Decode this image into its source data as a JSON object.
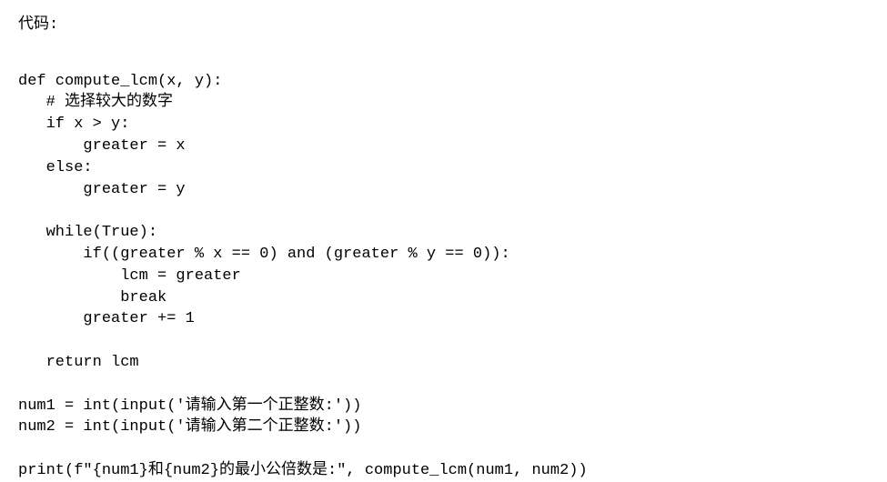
{
  "heading": "代码:",
  "code": {
    "line01": "def compute_lcm(x, y):",
    "line02": "   # 选择较大的数字",
    "line03": "   if x > y:",
    "line04": "       greater = x",
    "line05": "   else:",
    "line06": "       greater = y",
    "line07": "",
    "line08": "   while(True):",
    "line09": "       if((greater % x == 0) and (greater % y == 0)):",
    "line10": "           lcm = greater",
    "line11": "           break",
    "line12": "       greater += 1",
    "line13": "",
    "line14": "   return lcm",
    "line15": "",
    "line16": "num1 = int(input('请输入第一个正整数:'))",
    "line17": "num2 = int(input('请输入第二个正整数:'))",
    "line18": "",
    "line19": "print(f\"{num1}和{num2}的最小公倍数是:\", compute_lcm(num1, num2))"
  }
}
